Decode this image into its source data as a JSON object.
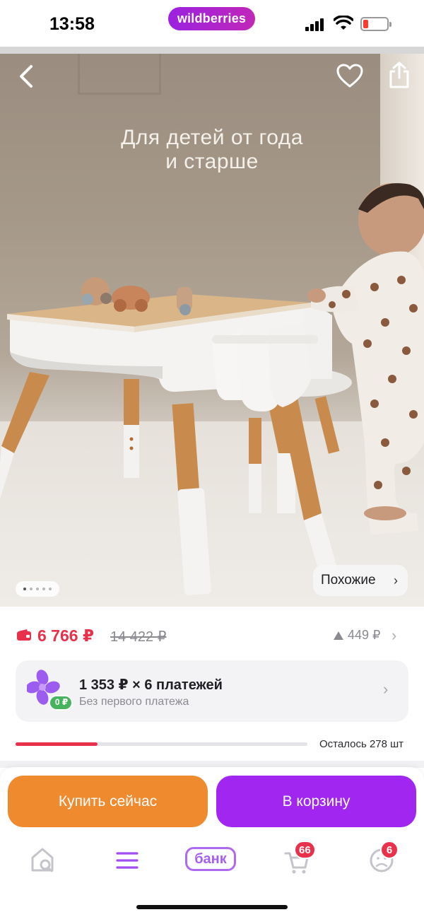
{
  "status_bar": {
    "time": "13:58",
    "brand": "wildberries",
    "icons": [
      "signal-icon",
      "wifi-icon",
      "battery-icon"
    ]
  },
  "hero": {
    "caption_line1": "Для детей от года",
    "caption_line2": "и старше",
    "similar_label": "Похожие",
    "image_index": 1,
    "image_count": 5,
    "icons": [
      "back-arrow-icon",
      "heart-icon",
      "share-icon"
    ]
  },
  "price": {
    "current": "6 766 ₽",
    "old": "14 422 ₽",
    "delta": "449 ₽",
    "color_accent": "#e8314a"
  },
  "installment": {
    "title": "1 353 ₽ × 6 платежей",
    "subtitle": "Без первого платежа",
    "zero_badge": "0 ₽"
  },
  "stock": {
    "label": "Осталось 278 шт",
    "fill_fraction": 0.28
  },
  "actions": {
    "buy_now": "Купить сейчас",
    "add_to_cart": "В корзину",
    "buy_color": "#f08a2e",
    "cart_color": "#a127f0"
  },
  "tabbar": {
    "bank_label": "банк",
    "basket_badge": "66",
    "profile_badge": "6",
    "icons": [
      "home-search-icon",
      "menu-icon",
      "bank-icon",
      "basket-icon",
      "profile-icon"
    ]
  }
}
